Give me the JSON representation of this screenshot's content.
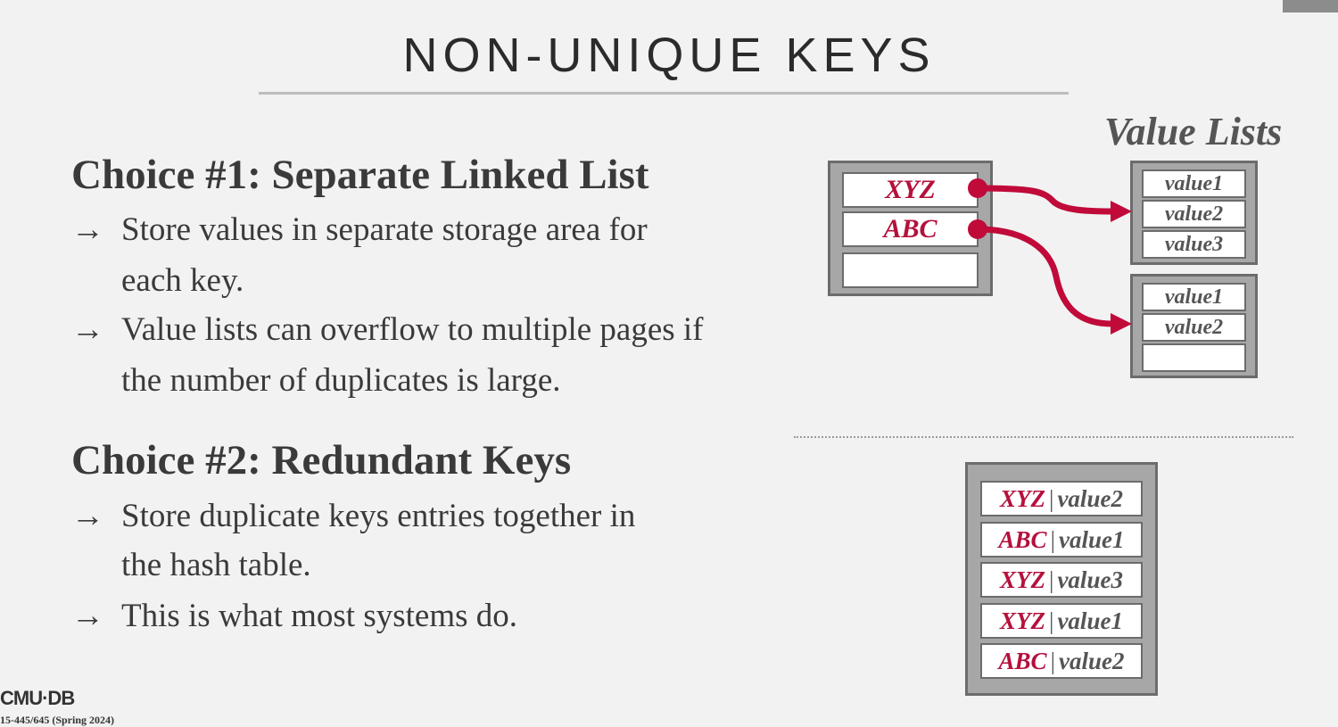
{
  "title": "NON-UNIQUE KEYS",
  "choice1": {
    "heading": "Choice #1: Separate Linked List",
    "bullets": [
      {
        "arrow": "→",
        "lines": [
          "Store values in separate storage area for",
          "each key."
        ]
      },
      {
        "arrow": "→",
        "lines": [
          "Value lists can overflow to multiple pages if",
          "the number of duplicates is large."
        ]
      }
    ]
  },
  "choice2": {
    "heading": "Choice #2: Redundant Keys",
    "bullets": [
      {
        "arrow": "→",
        "lines": [
          "Store duplicate keys entries together in",
          "the hash table."
        ]
      },
      {
        "arrow": "→",
        "lines": [
          "This is what most systems do."
        ]
      }
    ]
  },
  "diagram1": {
    "value_lists_label": "Value Lists",
    "hash_keys": [
      "XYZ",
      "ABC",
      ""
    ],
    "list1": [
      "value1",
      "value2",
      "value3"
    ],
    "list2": [
      "value1",
      "value2",
      ""
    ]
  },
  "diagram2": {
    "separator": "|",
    "entries": [
      {
        "key": "XYZ",
        "value": "value2"
      },
      {
        "key": "ABC",
        "value": "value1"
      },
      {
        "key": "XYZ",
        "value": "value3"
      },
      {
        "key": "XYZ",
        "value": "value1"
      },
      {
        "key": "ABC",
        "value": "value2"
      }
    ]
  },
  "colors": {
    "key": "#b5103c",
    "arrow": "#c00a3a",
    "box": "#a7a7a7",
    "border": "#6c6c6c"
  },
  "footer": {
    "logo": "CMU·DB",
    "course": "15-445/645 (Spring 2024)"
  }
}
